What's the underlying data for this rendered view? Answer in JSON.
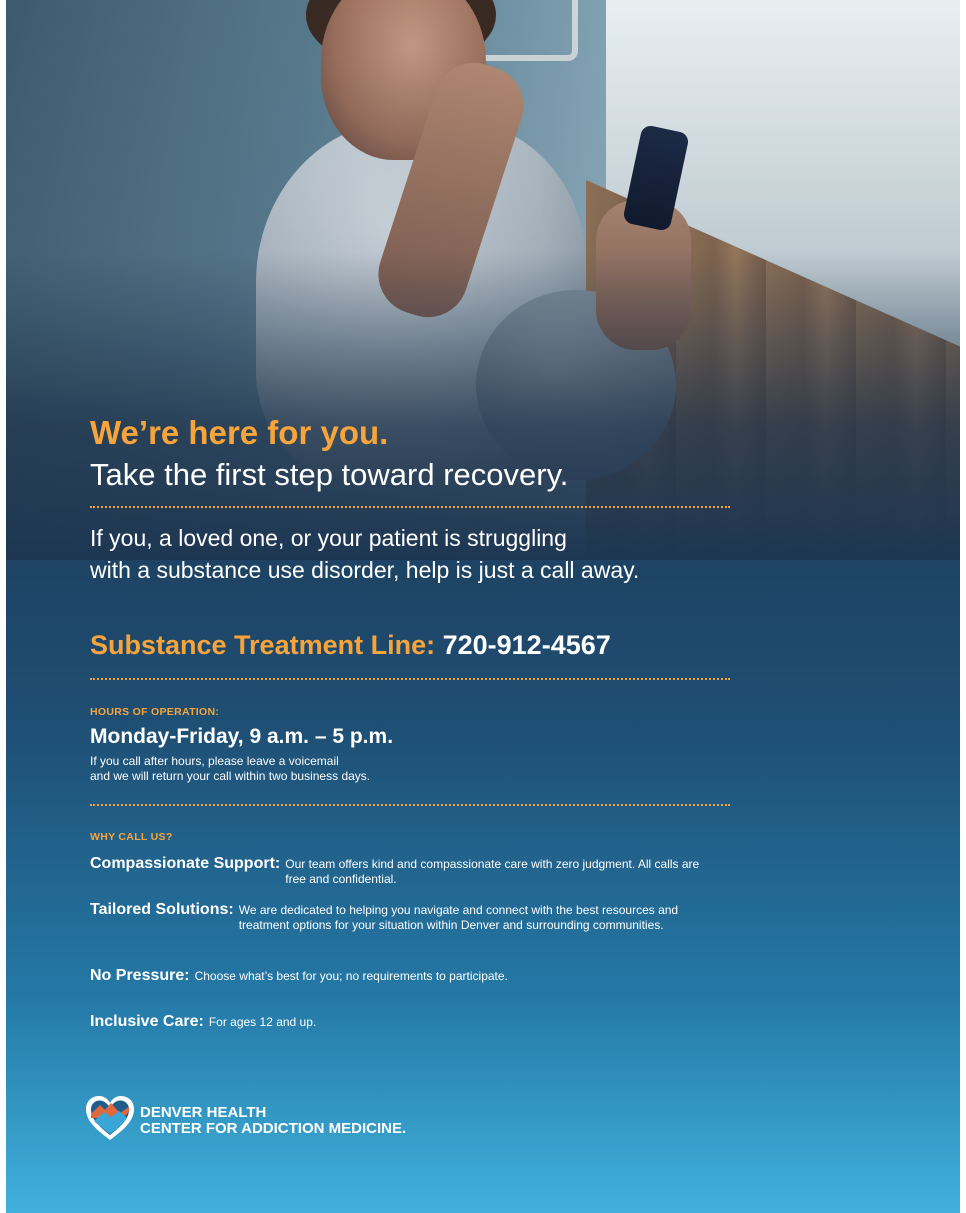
{
  "headline": "We’re here for you.",
  "subheadline": "Take the first step toward recovery.",
  "intro": {
    "line1": "If you, a loved one, or your patient is struggling",
    "line2": "with a substance use disorder, help is just a call away."
  },
  "phone": {
    "label": "Substance Treatment Line:",
    "number": "720-912-4567"
  },
  "hours": {
    "heading": "HOURS OF OPERATION:",
    "schedule": "Monday-Friday, 9 a.m. – 5 p.m.",
    "note_line1": "If you call after hours, please leave a voicemail",
    "note_line2": "and we will return your call within two business days."
  },
  "why": {
    "heading": "WHY CALL US?",
    "items": [
      {
        "title": "Compassionate Support:",
        "text": "Our team offers kind and compassionate care with zero judgment. All calls are free and confidential."
      },
      {
        "title": "Tailored Solutions:",
        "text": "We are dedicated to helping you navigate and connect with the best resources and treatment options for your situation within Denver and surrounding communities."
      },
      {
        "title": "No Pressure:",
        "text": "Choose what’s best for you; no requirements to participate."
      },
      {
        "title": "Inclusive Care:",
        "text": "For ages 12 and up."
      }
    ]
  },
  "logo": {
    "line1": "DENVER HEALTH",
    "line2": "CENTER FOR ADDICTION MEDICINE.",
    "icon": "heart-mountain-icon"
  },
  "colors": {
    "accent": "#f7a53b",
    "background_top": "#1c3149",
    "background_bottom": "#40b1dc"
  }
}
